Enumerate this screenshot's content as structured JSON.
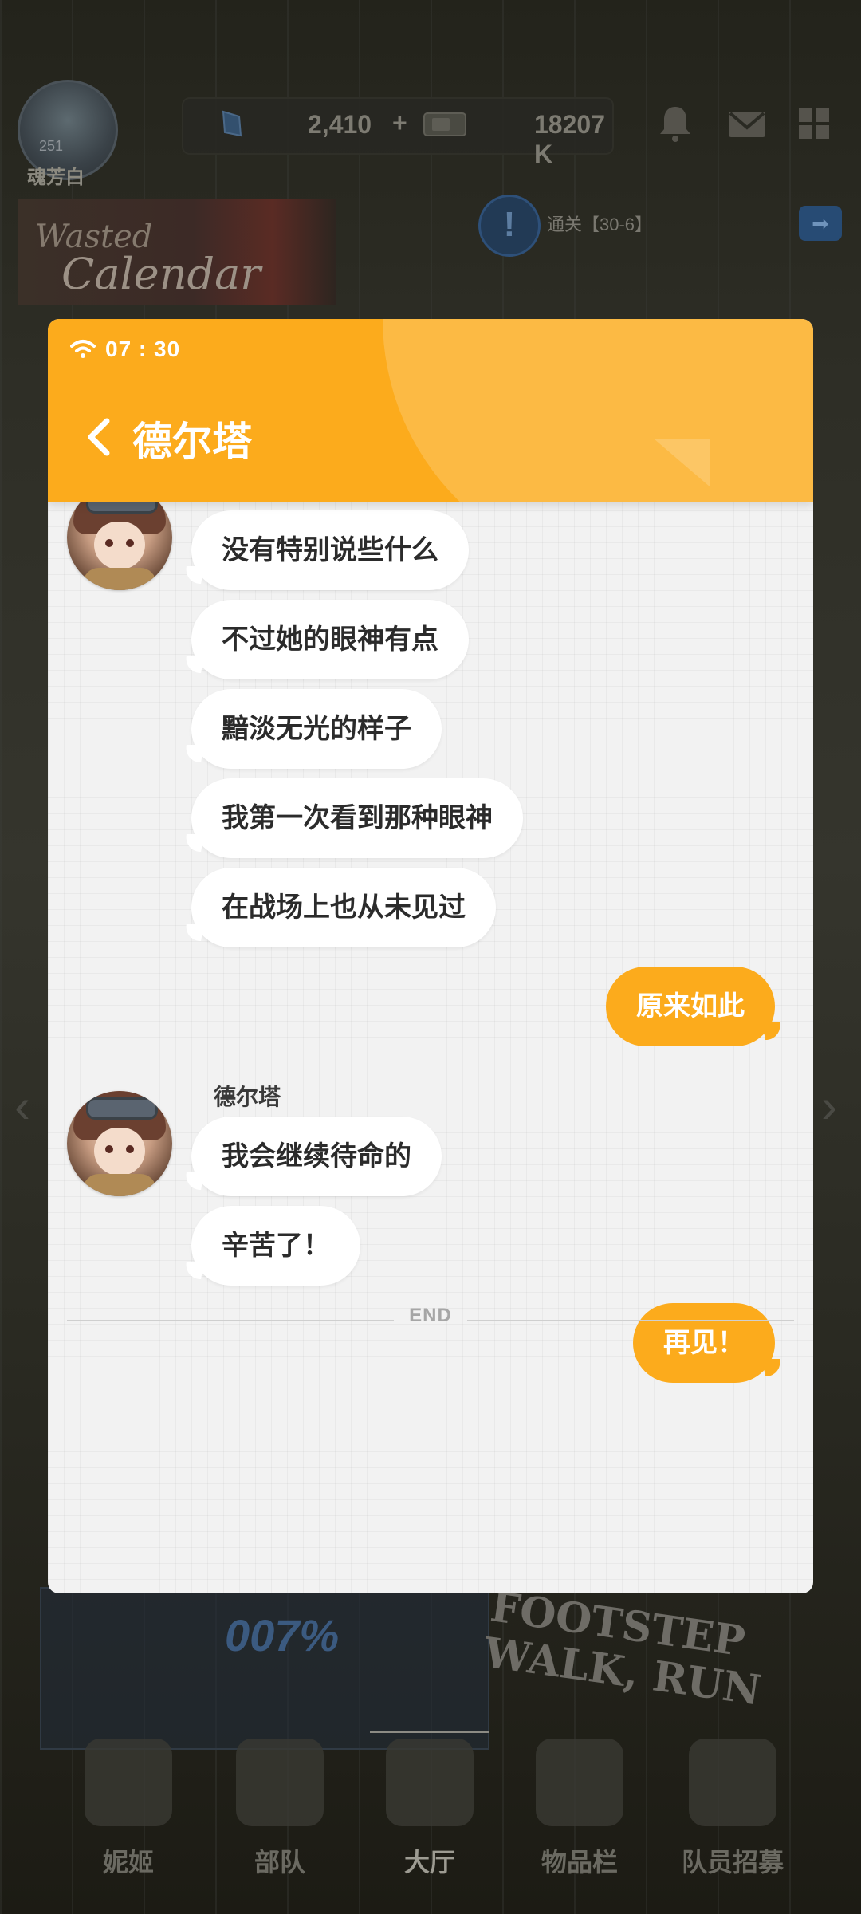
{
  "top": {
    "player_name": "魂芳白",
    "level": "251",
    "gems": "2,410",
    "gems_plus": "+",
    "credits": "18207 K",
    "banner_line1": "Wasted",
    "banner_line2": "Calendar",
    "mission_text": "通关【30-6】",
    "mission_warn": "!",
    "mission_go": "➡"
  },
  "background": {
    "panel_text": "007%",
    "foot_text_1": "FOOTSTEP",
    "foot_text_2": "WALK, RUN"
  },
  "bottom_nav": {
    "items": [
      {
        "label": "妮姬"
      },
      {
        "label": "部队"
      },
      {
        "label": "大厅"
      },
      {
        "label": "物品栏"
      },
      {
        "label": "队员招募"
      }
    ]
  },
  "chat": {
    "status_time": "07 : 30",
    "title": "德尔塔",
    "messages_incoming_1": [
      "没有特别说些什么",
      "不过她的眼神有点",
      "黯淡无光的样子",
      "我第一次看到那种眼神",
      "在战场上也从未见过"
    ],
    "reply_1": "原来如此",
    "sender_name": "德尔塔",
    "messages_incoming_2": [
      "我会继续待命的",
      "辛苦了！"
    ],
    "reply_2": "再见！",
    "end_label": "END"
  },
  "colors": {
    "accent": "#fcab1c",
    "chat_bg": "#f2f2f2",
    "bubble_in": "#ffffff",
    "text_dark": "#2b2b2b"
  }
}
